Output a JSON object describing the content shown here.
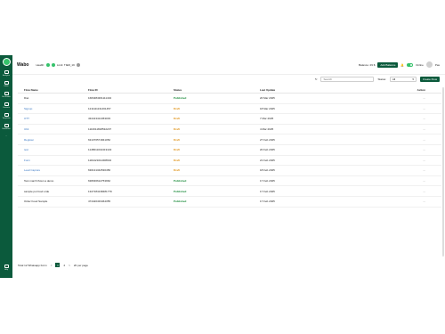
{
  "app": {
    "brand": "Wabo"
  },
  "sidebar": {
    "items": [
      {
        "label": "Analytics",
        "icon": "chart-icon"
      },
      {
        "label": "Inbox",
        "icon": "inbox-icon"
      },
      {
        "label": "Bot Studio",
        "icon": "bot-icon"
      },
      {
        "label": "Contacts",
        "icon": "contacts-icon"
      },
      {
        "label": "Templates",
        "icon": "templates-icon"
      },
      {
        "label": "Broadcast",
        "icon": "broadcast-icon"
      },
      {
        "label": "...",
        "icon": "more-icon"
      }
    ],
    "help": "Help"
  },
  "header": {
    "health_label": "Health:",
    "limit_label": "Limit: TIER_1K",
    "balance_label": "Balance: 29 $",
    "add_balance": "Add Balance",
    "online_label": "Online",
    "user": "Pas"
  },
  "toolbar": {
    "search_placeholder": "Search",
    "status_label": "Status:",
    "status_value": "All",
    "create_label": "Create Flow"
  },
  "table": {
    "headers": [
      "Flow Name",
      "Flow ID",
      "Status",
      "Last Update",
      "Action"
    ],
    "rows": [
      {
        "name": "Diet",
        "id": "1684384361111434",
        "status": "Published",
        "date": "20 Mar 2025"
      },
      {
        "name": "Signup",
        "id": "1211111131461457",
        "status": "Draft",
        "date": "18 Mar 2025"
      },
      {
        "name": "OTT",
        "id": "434413414453033",
        "status": "Draft",
        "date": "7 Mar 2025"
      },
      {
        "name": "Ubit",
        "id": "1113611818532237",
        "status": "Draft",
        "date": "4 Mar 2025"
      },
      {
        "name": "Register",
        "id": "631376571841052",
        "status": "Draft",
        "date": "27 Feb 2025"
      },
      {
        "name": "test",
        "id": "1148611042419132",
        "status": "Draft",
        "date": "20 Feb 2025"
      },
      {
        "name": "Form",
        "id": "1119421011308934",
        "status": "Draft",
        "date": "21 Feb 2025"
      },
      {
        "name": "Lead Capture",
        "id": "630131342530456",
        "status": "Draft",
        "date": "18 Feb 2025"
      },
      {
        "name": "Test march flown a demo",
        "id": "638036612753962",
        "status": "Published",
        "date": "17 Feb 2025"
      },
      {
        "name": "sample pot food orde",
        "id": "1327184138481779",
        "status": "Published",
        "date": "17 Feb 2025"
      },
      {
        "name": "Order Food Sample",
        "id": "474420433464355",
        "status": "Published",
        "date": "17 Feb 2025"
      }
    ],
    "action_symbol": "..."
  },
  "pager": {
    "total": "Total 12 Whatsapp Form",
    "prev": "<",
    "page1": "1",
    "page2": "2",
    "next": ">",
    "per_page": "20 per page"
  }
}
